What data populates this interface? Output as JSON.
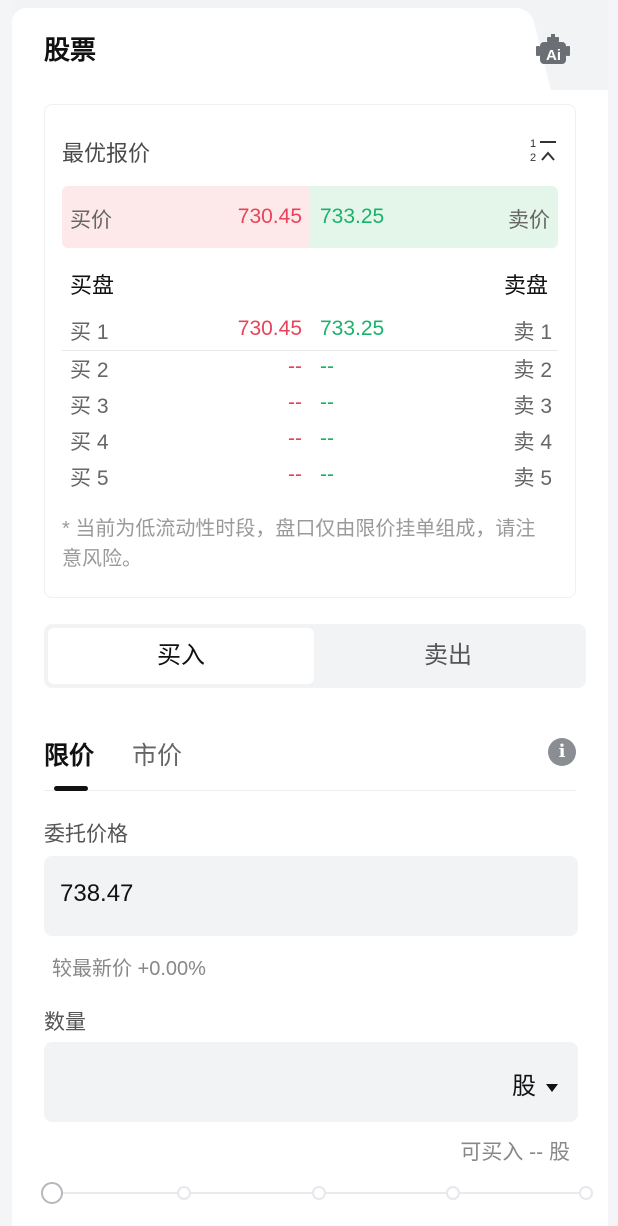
{
  "header": {
    "tab_title": "股票",
    "ai_icon": "robot-ai-icon"
  },
  "quote": {
    "title": "最优报价",
    "sort_icon": "sort-1-2-icon",
    "best": {
      "bid_label": "买价",
      "bid_price": "730.45",
      "ask_price": "733.25",
      "ask_label": "卖价"
    },
    "bid_side_label": "买盘",
    "ask_side_label": "卖盘",
    "levels": [
      {
        "bid_label": "买 1",
        "bid": "730.45",
        "ask": "733.25",
        "ask_label": "卖 1"
      },
      {
        "bid_label": "买 2",
        "bid": "--",
        "ask": "--",
        "ask_label": "卖 2"
      },
      {
        "bid_label": "买 3",
        "bid": "--",
        "ask": "--",
        "ask_label": "卖 3"
      },
      {
        "bid_label": "买 4",
        "bid": "--",
        "ask": "--",
        "ask_label": "卖 4"
      },
      {
        "bid_label": "买 5",
        "bid": "--",
        "ask": "--",
        "ask_label": "卖 5"
      }
    ],
    "notice": "* 当前为低流动性时段，盘口仅由限价挂单组成，请注意风险。"
  },
  "trade_side": {
    "buy": "买入",
    "sell": "卖出",
    "selected": "买入"
  },
  "order_type": {
    "limit": "限价",
    "market": "市价",
    "selected": "限价"
  },
  "order": {
    "price_label": "委托价格",
    "price_value": "738.47",
    "change_note": "较最新价 +0.00%",
    "qty_label": "数量",
    "qty_unit": "股",
    "available": "可买入 -- 股",
    "slider_value": 0
  },
  "colors": {
    "bid": "#e8435a",
    "ask": "#1bb26b",
    "bid_bg": "#fde9e9",
    "ask_bg": "#e4f6ea"
  }
}
